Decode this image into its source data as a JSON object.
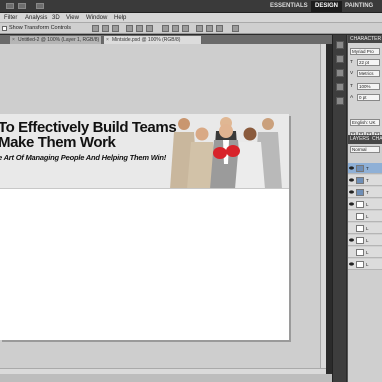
{
  "app_bar": {
    "workspaces": [
      {
        "label": "ESSENTIALS",
        "active": false
      },
      {
        "label": "DESIGN",
        "active": true
      },
      {
        "label": "PAINTING",
        "active": false
      }
    ]
  },
  "menu": {
    "items": [
      "Filter",
      "Analysis",
      "3D",
      "View",
      "Window",
      "Help"
    ]
  },
  "options_bar": {
    "show_transform_label": "Show Transform Controls",
    "show_transform_checked": false
  },
  "tabs": [
    {
      "label": "Untitled-2 @ 100% (Layer 1, RGB/8)",
      "active": false
    },
    {
      "label": "Mintside.psd @ 100% (RGB/8)",
      "active": true
    }
  ],
  "document": {
    "headline_line1": "To  Effectively Build Teams",
    "headline_line2": "Make Them Work",
    "tagline": "e Art Of Managing People And Helping Them Win!"
  },
  "character_panel": {
    "title": "CHARACTER",
    "font_family": "Myriad Pro",
    "font_size": "22 pt",
    "leading": "Metrics",
    "scale": "100%",
    "baseline": "0 pt",
    "language": "English: UK",
    "style_buttons": [
      "T",
      "T",
      "T",
      "T"
    ]
  },
  "layers_panel": {
    "tabs": [
      "LAYERS",
      "CHA"
    ],
    "blend_mode": "Normal",
    "layers": [
      {
        "name": "T",
        "type": "text",
        "visible": true,
        "selected": true
      },
      {
        "name": "T",
        "type": "text",
        "visible": true,
        "selected": false
      },
      {
        "name": "T",
        "type": "text",
        "visible": true,
        "selected": false
      },
      {
        "name": "L",
        "type": "image",
        "visible": true,
        "selected": false
      },
      {
        "name": "L",
        "type": "image",
        "visible": false,
        "selected": false
      },
      {
        "name": "L",
        "type": "image",
        "visible": false,
        "selected": false
      },
      {
        "name": "L",
        "type": "image",
        "visible": true,
        "selected": false
      },
      {
        "name": "L",
        "type": "image",
        "visible": false,
        "selected": false
      },
      {
        "name": "L",
        "type": "image",
        "visible": true,
        "selected": false
      }
    ]
  },
  "colors": {
    "accent_selected": "#8fb0d6",
    "boxing_glove": "#d8232a"
  }
}
